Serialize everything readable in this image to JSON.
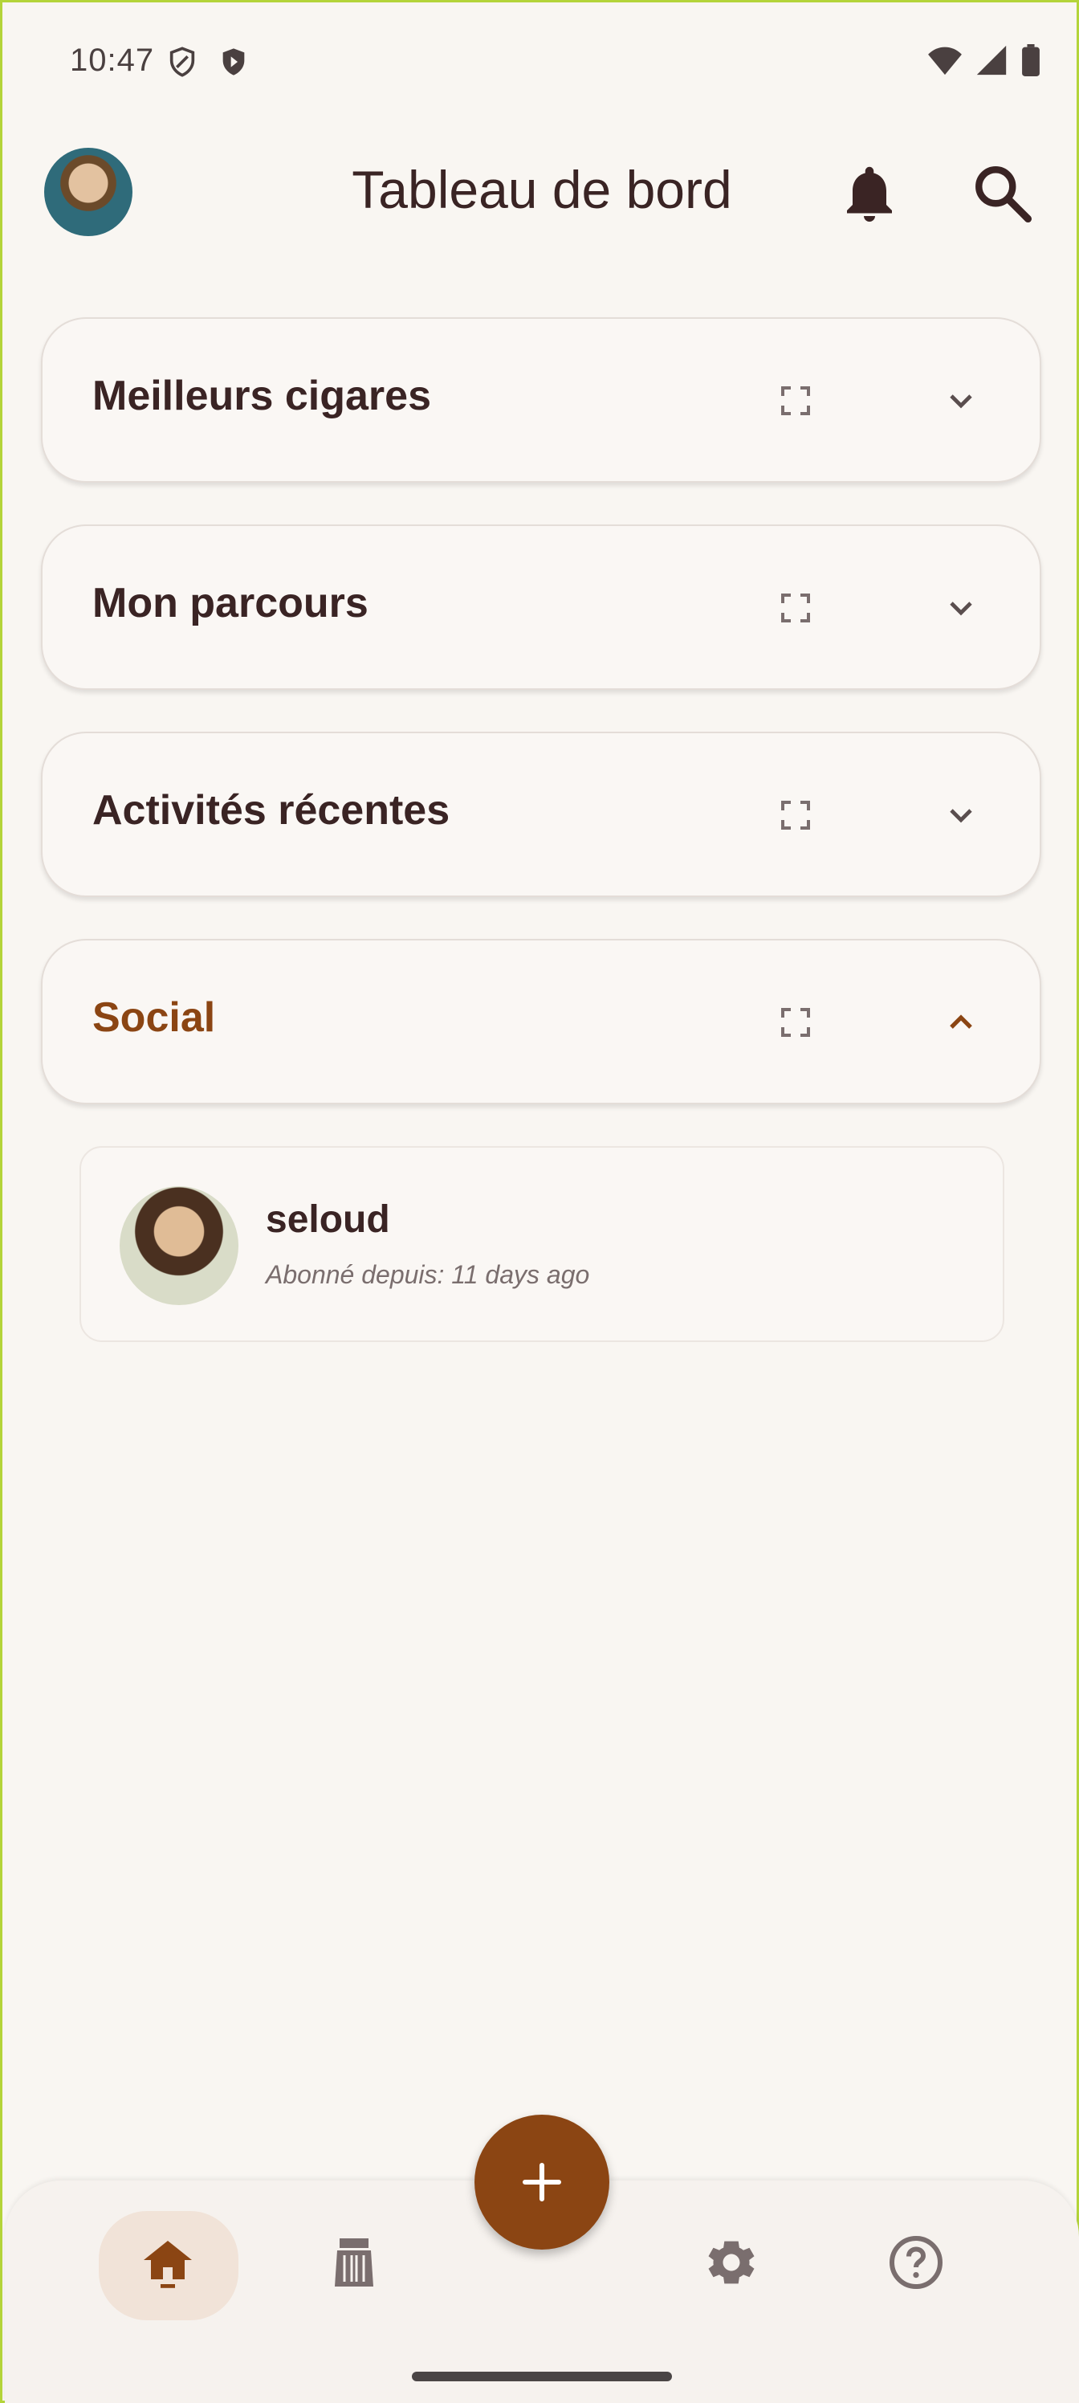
{
  "status_bar": {
    "time": "10:47"
  },
  "header": {
    "title": "Tableau de bord"
  },
  "sections": [
    {
      "title": "Meilleurs cigares",
      "expanded": false
    },
    {
      "title": "Mon parcours",
      "expanded": false
    },
    {
      "title": "Activités récentes",
      "expanded": false
    },
    {
      "title": "Social",
      "expanded": true
    }
  ],
  "social": {
    "followers": [
      {
        "username": "seloud",
        "meta": "Abonné depuis: 11 days ago"
      }
    ]
  },
  "colors": {
    "accent": "#8b4513",
    "text": "#3a2424",
    "background": "#f9f6f2"
  },
  "bottom_nav": {
    "items": [
      {
        "icon": "home-icon",
        "active": true
      },
      {
        "icon": "humidor-icon",
        "active": false
      },
      {
        "icon": "gear-icon",
        "active": false
      },
      {
        "icon": "help-icon",
        "active": false
      }
    ],
    "fab_icon": "plus-icon"
  }
}
